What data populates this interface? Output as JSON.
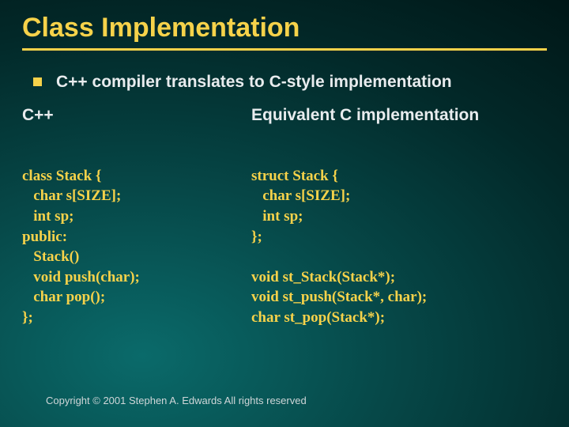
{
  "title": "Class Implementation",
  "bullet": "C++ compiler translates to C-style implementation",
  "left": {
    "heading": "C++",
    "lines": [
      "class Stack {",
      "   char s[SIZE];",
      "   int sp;",
      "public:",
      "   Stack()",
      "   void push(char);",
      "   char pop();",
      "};"
    ]
  },
  "right": {
    "heading": "Equivalent C implementation",
    "lines": [
      "struct Stack {",
      "   char s[SIZE];",
      "   int sp;",
      "};",
      "",
      "void st_Stack(Stack*);",
      "void st_push(Stack*, char);",
      "char st_pop(Stack*);"
    ]
  },
  "copyright": "Copyright © 2001 Stephen A. Edwards  All rights reserved"
}
